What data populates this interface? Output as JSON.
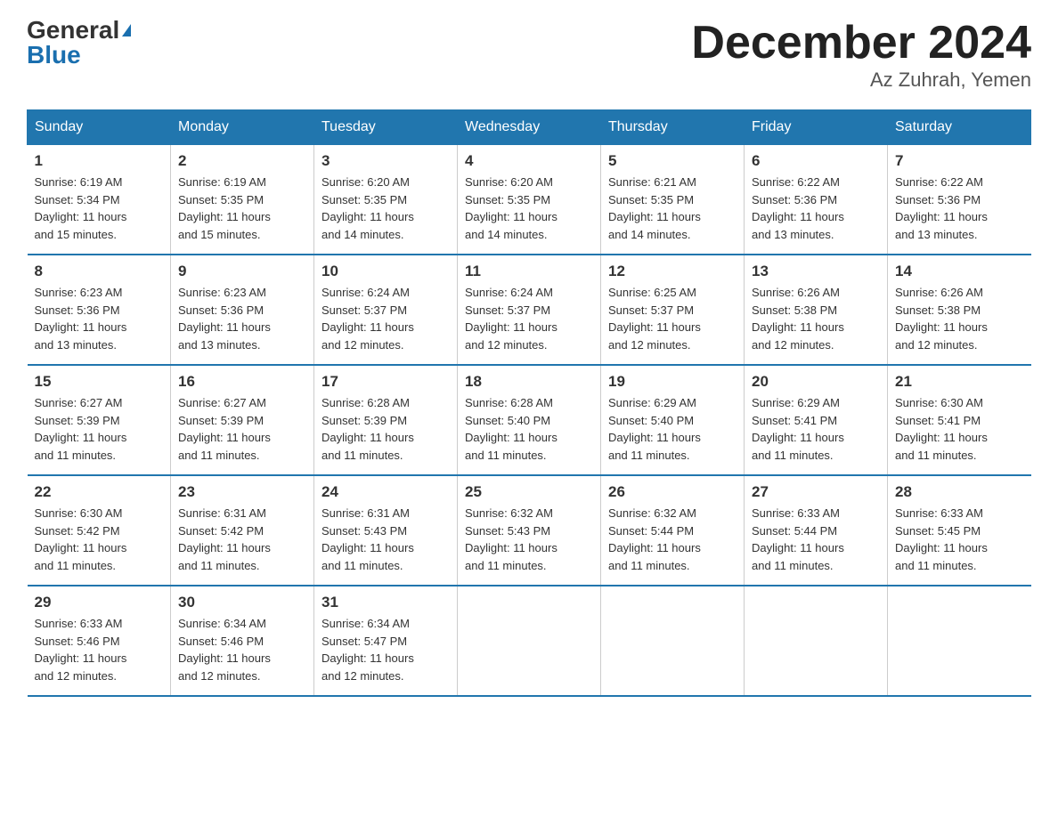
{
  "logo": {
    "general": "General",
    "blue": "Blue"
  },
  "title": "December 2024",
  "location": "Az Zuhrah, Yemen",
  "days_of_week": [
    "Sunday",
    "Monday",
    "Tuesday",
    "Wednesday",
    "Thursday",
    "Friday",
    "Saturday"
  ],
  "weeks": [
    [
      {
        "day": "1",
        "sunrise": "6:19 AM",
        "sunset": "5:34 PM",
        "daylight": "11 hours and 15 minutes."
      },
      {
        "day": "2",
        "sunrise": "6:19 AM",
        "sunset": "5:35 PM",
        "daylight": "11 hours and 15 minutes."
      },
      {
        "day": "3",
        "sunrise": "6:20 AM",
        "sunset": "5:35 PM",
        "daylight": "11 hours and 14 minutes."
      },
      {
        "day": "4",
        "sunrise": "6:20 AM",
        "sunset": "5:35 PM",
        "daylight": "11 hours and 14 minutes."
      },
      {
        "day": "5",
        "sunrise": "6:21 AM",
        "sunset": "5:35 PM",
        "daylight": "11 hours and 14 minutes."
      },
      {
        "day": "6",
        "sunrise": "6:22 AM",
        "sunset": "5:36 PM",
        "daylight": "11 hours and 13 minutes."
      },
      {
        "day": "7",
        "sunrise": "6:22 AM",
        "sunset": "5:36 PM",
        "daylight": "11 hours and 13 minutes."
      }
    ],
    [
      {
        "day": "8",
        "sunrise": "6:23 AM",
        "sunset": "5:36 PM",
        "daylight": "11 hours and 13 minutes."
      },
      {
        "day": "9",
        "sunrise": "6:23 AM",
        "sunset": "5:36 PM",
        "daylight": "11 hours and 13 minutes."
      },
      {
        "day": "10",
        "sunrise": "6:24 AM",
        "sunset": "5:37 PM",
        "daylight": "11 hours and 12 minutes."
      },
      {
        "day": "11",
        "sunrise": "6:24 AM",
        "sunset": "5:37 PM",
        "daylight": "11 hours and 12 minutes."
      },
      {
        "day": "12",
        "sunrise": "6:25 AM",
        "sunset": "5:37 PM",
        "daylight": "11 hours and 12 minutes."
      },
      {
        "day": "13",
        "sunrise": "6:26 AM",
        "sunset": "5:38 PM",
        "daylight": "11 hours and 12 minutes."
      },
      {
        "day": "14",
        "sunrise": "6:26 AM",
        "sunset": "5:38 PM",
        "daylight": "11 hours and 12 minutes."
      }
    ],
    [
      {
        "day": "15",
        "sunrise": "6:27 AM",
        "sunset": "5:39 PM",
        "daylight": "11 hours and 11 minutes."
      },
      {
        "day": "16",
        "sunrise": "6:27 AM",
        "sunset": "5:39 PM",
        "daylight": "11 hours and 11 minutes."
      },
      {
        "day": "17",
        "sunrise": "6:28 AM",
        "sunset": "5:39 PM",
        "daylight": "11 hours and 11 minutes."
      },
      {
        "day": "18",
        "sunrise": "6:28 AM",
        "sunset": "5:40 PM",
        "daylight": "11 hours and 11 minutes."
      },
      {
        "day": "19",
        "sunrise": "6:29 AM",
        "sunset": "5:40 PM",
        "daylight": "11 hours and 11 minutes."
      },
      {
        "day": "20",
        "sunrise": "6:29 AM",
        "sunset": "5:41 PM",
        "daylight": "11 hours and 11 minutes."
      },
      {
        "day": "21",
        "sunrise": "6:30 AM",
        "sunset": "5:41 PM",
        "daylight": "11 hours and 11 minutes."
      }
    ],
    [
      {
        "day": "22",
        "sunrise": "6:30 AM",
        "sunset": "5:42 PM",
        "daylight": "11 hours and 11 minutes."
      },
      {
        "day": "23",
        "sunrise": "6:31 AM",
        "sunset": "5:42 PM",
        "daylight": "11 hours and 11 minutes."
      },
      {
        "day": "24",
        "sunrise": "6:31 AM",
        "sunset": "5:43 PM",
        "daylight": "11 hours and 11 minutes."
      },
      {
        "day": "25",
        "sunrise": "6:32 AM",
        "sunset": "5:43 PM",
        "daylight": "11 hours and 11 minutes."
      },
      {
        "day": "26",
        "sunrise": "6:32 AM",
        "sunset": "5:44 PM",
        "daylight": "11 hours and 11 minutes."
      },
      {
        "day": "27",
        "sunrise": "6:33 AM",
        "sunset": "5:44 PM",
        "daylight": "11 hours and 11 minutes."
      },
      {
        "day": "28",
        "sunrise": "6:33 AM",
        "sunset": "5:45 PM",
        "daylight": "11 hours and 11 minutes."
      }
    ],
    [
      {
        "day": "29",
        "sunrise": "6:33 AM",
        "sunset": "5:46 PM",
        "daylight": "11 hours and 12 minutes."
      },
      {
        "day": "30",
        "sunrise": "6:34 AM",
        "sunset": "5:46 PM",
        "daylight": "11 hours and 12 minutes."
      },
      {
        "day": "31",
        "sunrise": "6:34 AM",
        "sunset": "5:47 PM",
        "daylight": "11 hours and 12 minutes."
      },
      null,
      null,
      null,
      null
    ]
  ],
  "labels": {
    "sunrise": "Sunrise:",
    "sunset": "Sunset:",
    "daylight": "Daylight:"
  }
}
